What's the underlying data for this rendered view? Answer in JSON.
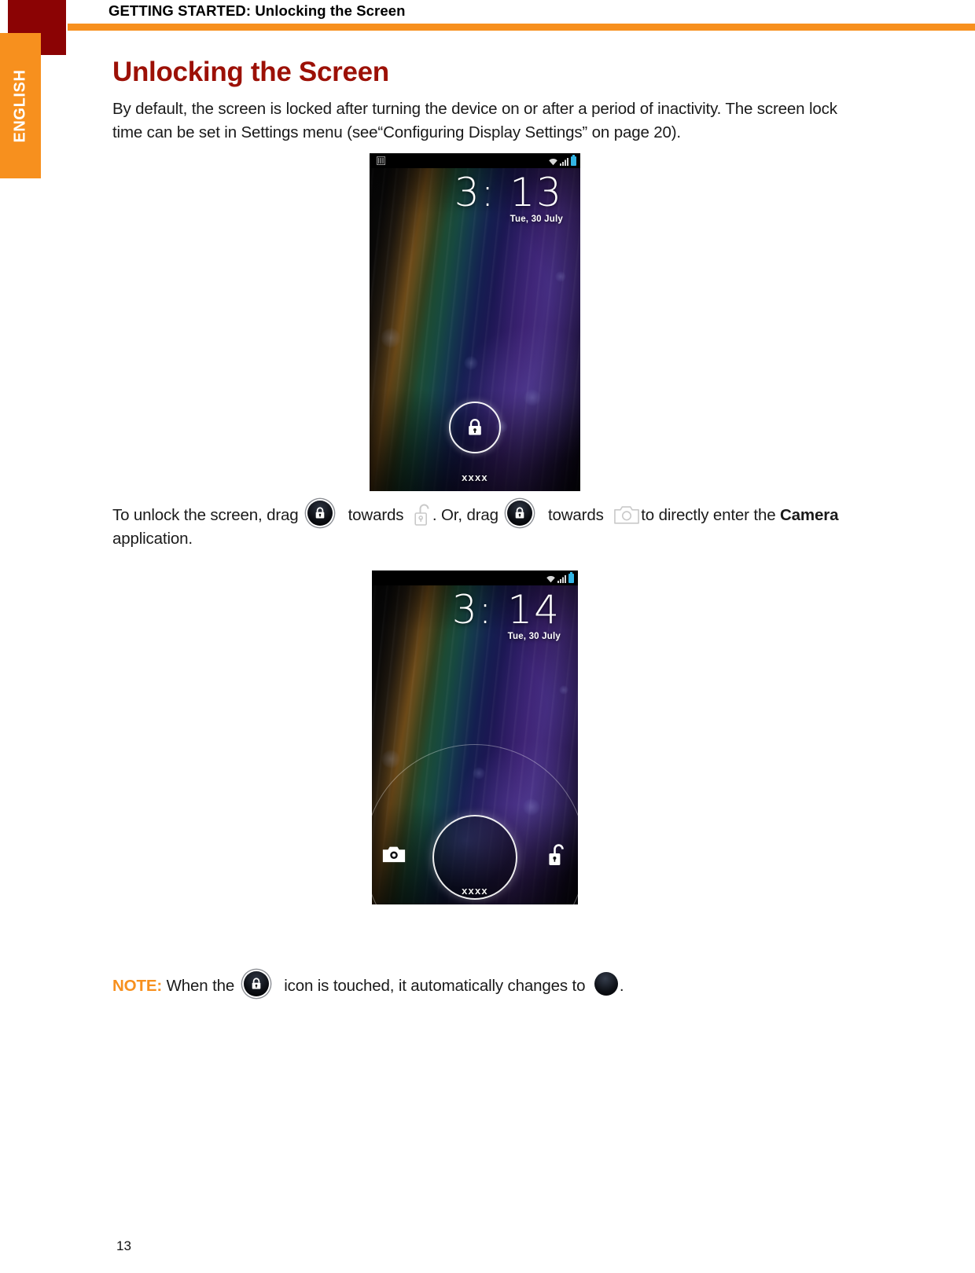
{
  "header": {
    "breadcrumb": "GETTING STARTED: Unlocking the Screen",
    "accent_color": "#f7901e",
    "square_color": "#8b0304"
  },
  "language_tab": {
    "label": "ENGLISH",
    "background": "#f7901e",
    "text_color": "#ffffff"
  },
  "main": {
    "heading": "Unlocking the Screen",
    "heading_color": "#9c1006",
    "intro_paragraph": "By default, the screen is locked after turning the device on or after a period of inactivity. The screen lock time can be set in Settings menu (see“Configuring Display Settings” on page 20).",
    "instruction": {
      "part1": "To unlock the screen, drag",
      "part2": "towards",
      "part3": ". Or, drag",
      "part4": "towards",
      "part5": "to directly enter the",
      "app_name": "Camera",
      "part6": "application."
    }
  },
  "figure_locked": {
    "caption": "Android lock screen, locked state",
    "status_bar": {
      "left_icon": "sim-card-icon",
      "wifi_icon": "wifi-icon",
      "signal_icon": "cellular-signal-icon",
      "battery_icon": "battery-icon",
      "battery_color": "#33b5e5"
    },
    "time": "3: 13",
    "date": "Tue, 30 July",
    "lock_handle_icon": "lock-closed-icon",
    "carrier_label": "xxxx"
  },
  "figure_unlocking": {
    "caption": "Android lock screen, drag ring expanded",
    "status_bar": {
      "wifi_icon": "wifi-icon",
      "signal_icon": "cellular-signal-icon",
      "battery_icon": "battery-icon",
      "battery_color": "#33b5e5"
    },
    "time": "3: 14",
    "date": "Tue, 30 July",
    "left_target_icon": "camera-icon",
    "right_target_icon": "lock-open-icon",
    "carrier_label": "xxxx"
  },
  "note": {
    "label": "NOTE:",
    "label_color": "#f7901e",
    "part1": "When the",
    "part2": "icon is touched, it automatically changes to",
    "part3": ".",
    "icon_before": "lock-badge-icon",
    "icon_after": "dot-badge-icon"
  },
  "footer": {
    "page_number": "13"
  }
}
